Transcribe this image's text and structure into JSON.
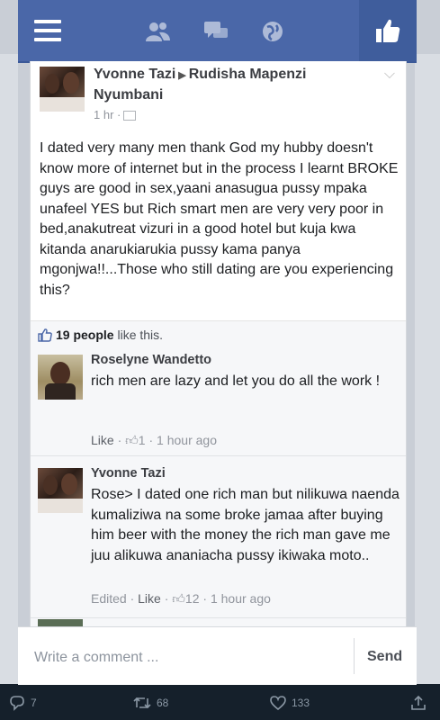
{
  "fb_bar": {
    "menu_icon": "hamburger-icon",
    "nav_icons": [
      "friends-icon",
      "messages-icon",
      "globe-icon"
    ],
    "like_icon": "thumbs-up-icon"
  },
  "post": {
    "author": "Yvonne Tazi",
    "target": "Rudisha Mapenzi Nyumbani",
    "time": "1 hr ·",
    "text": "I dated very many men thank God my hubby doesn't know more of internet but in the process I learnt BROKE guys are good in sex,yaani anasugua pussy mpaka unafeel YES but Rich smart men are very very poor in bed,anakutreat vizuri in a good hotel but kuja kwa kitanda anarukiarukia pussy kama panya mgonjwa!!...Those who still dating are you experiencing this?",
    "likes_count": "19 people",
    "likes_suffix": "like this."
  },
  "comments": [
    {
      "name": "Roselyne Wandetto",
      "text": "rich men are lazy and let you do all the work !",
      "meta_prefix": "",
      "like": "Like",
      "like_count": "1",
      "time": "1 hour ago"
    },
    {
      "name": "Yvonne Tazi",
      "text": "Rose> I dated one rich man but nilikuwa naenda kumaliziwa na some broke jamaa after buying him beer with the money the rich man gave me juu alikuwa ananiacha pussy ikiwaka moto..",
      "meta_prefix": "Edited ·",
      "like": "Like",
      "like_count": "12",
      "time": "1 hour ago"
    }
  ],
  "compose": {
    "placeholder": "Write a comment ...",
    "send": "Send"
  },
  "tweet_actions": {
    "replies": "7",
    "retweets": "68",
    "likes": "133"
  },
  "colors": {
    "facebook_blue": "#4a67a8",
    "twitter_bg": "#15202b"
  }
}
